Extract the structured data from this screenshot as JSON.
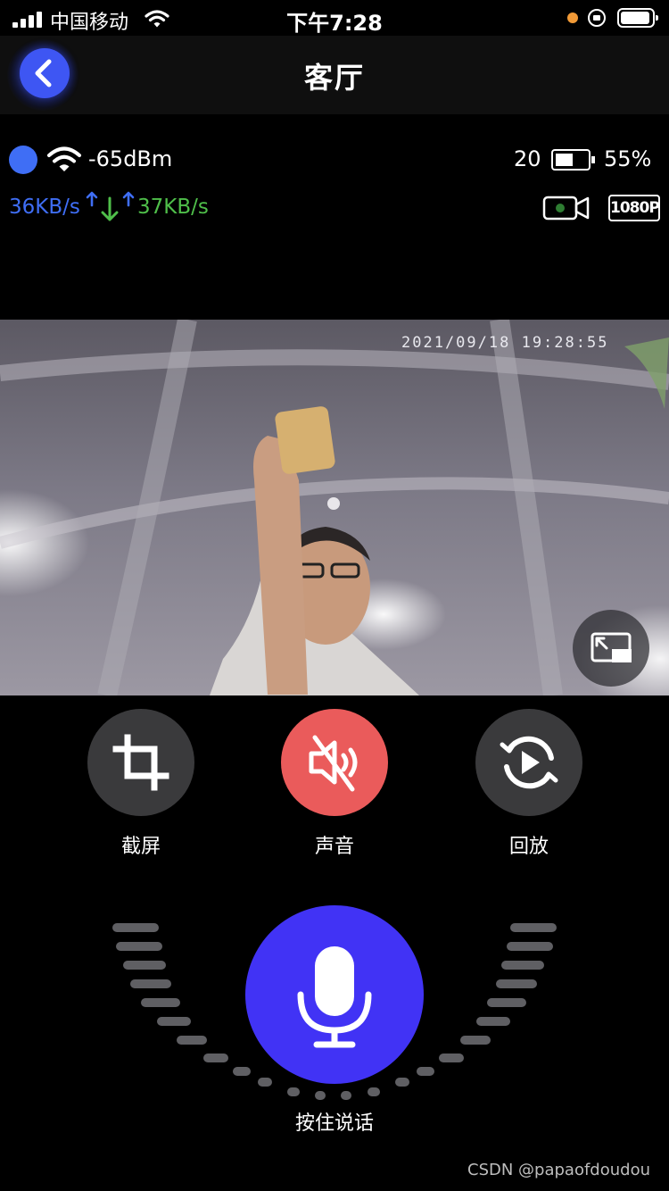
{
  "status_bar": {
    "carrier": "中国移动",
    "time": "下午7:28"
  },
  "nav": {
    "title": "客厅",
    "back_icon": "chevron-left-icon"
  },
  "device": {
    "signal": "-65dBm",
    "temperature": "20",
    "battery_level": 0.55,
    "battery": "55%",
    "download_rate": "36KB/s",
    "upload_rate": "37KB/s",
    "resolution": "1080P",
    "colors": {
      "online": "#3f6ef5",
      "download": "#3f6ef5",
      "upload": "#4fbf4a",
      "record_dot": "#2e7d32"
    }
  },
  "video": {
    "timestamp": "2021/09/18 19:28:55",
    "fullscreen_icon": "picture-in-picture-icon"
  },
  "controls": [
    {
      "label": "截屏",
      "icon": "crop-icon",
      "color": "#3a3a3c"
    },
    {
      "label": "声音",
      "icon": "speaker-muted-icon",
      "color": "#ea5b5b"
    },
    {
      "label": "回放",
      "icon": "replay-icon",
      "color": "#3a3a3c"
    }
  ],
  "talk": {
    "label": "按住说话",
    "icon": "microphone-icon",
    "color": "#4133f5"
  },
  "watermark": "CSDN @papaofdoudou"
}
